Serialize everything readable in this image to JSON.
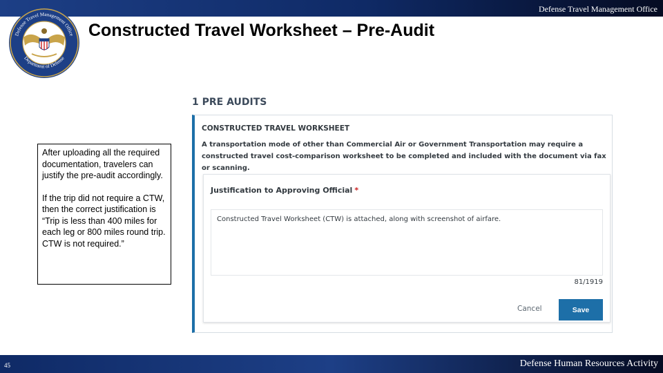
{
  "header": {
    "office_name": "Defense Travel Management Office",
    "seal_top_text": "Defense Travel Management Office",
    "seal_bottom_text": "Department of Defense",
    "title": "Constructed Travel Worksheet – Pre-Audit"
  },
  "callout": {
    "paragraph_1": "After uploading all the required documentation, travelers can justify the pre-audit accordingly.",
    "paragraph_2": "If the trip did not require a CTW, then the correct justification is “Trip is less than 400 miles for each leg or 800 miles round trip. CTW is not required.”"
  },
  "screenshot": {
    "section_heading": "1 PRE AUDITS",
    "panel_heading": "CONSTRUCTED TRAVEL WORKSHEET",
    "panel_description": "A transportation mode of other than Commercial Air or Government Transportation may require a constructed travel cost-comparison worksheet to be completed and included with the document via fax or scanning.",
    "justification_label": "Justification to Approving Official",
    "required_marker": "*",
    "justification_value": "Constructed Travel Worksheet (CTW) is attached, along with screenshot of airfare.",
    "char_count": "81/1919",
    "cancel_label": "Cancel",
    "save_label": "Save"
  },
  "footer": {
    "slide_number": "45",
    "organization": "Defense Human Resources Activity"
  },
  "colors": {
    "top_bar": "#1d3f86",
    "accent_blue": "#1d6fa8",
    "required_red": "#cc2222",
    "seal_gold": "#c9a44a"
  }
}
